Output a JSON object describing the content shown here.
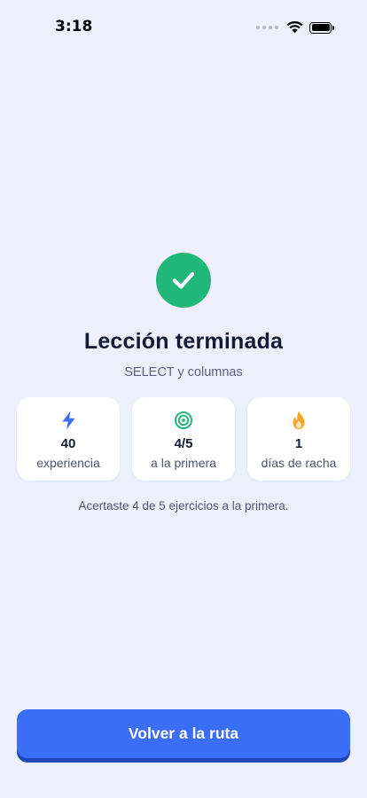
{
  "status_bar": {
    "time": "3:18"
  },
  "result": {
    "title": "Lección terminada",
    "subtitle": "SELECT y columnas",
    "accent_color": "#21b77a",
    "stats": [
      {
        "icon": "lightning-icon",
        "value": "40",
        "label": "experiencia",
        "color": "#3b6ef6"
      },
      {
        "icon": "target-icon",
        "value": "4/5",
        "label": "a la primera",
        "color": "#21b77a"
      },
      {
        "icon": "flame-icon",
        "value": "1",
        "label": "días de racha",
        "color": "#f5a623"
      }
    ],
    "summary": "Acertaste 4 de 5 ejercicios a la primera."
  },
  "actions": {
    "primary_label": "Volver a la ruta",
    "primary_color": "#3b6ef6"
  }
}
